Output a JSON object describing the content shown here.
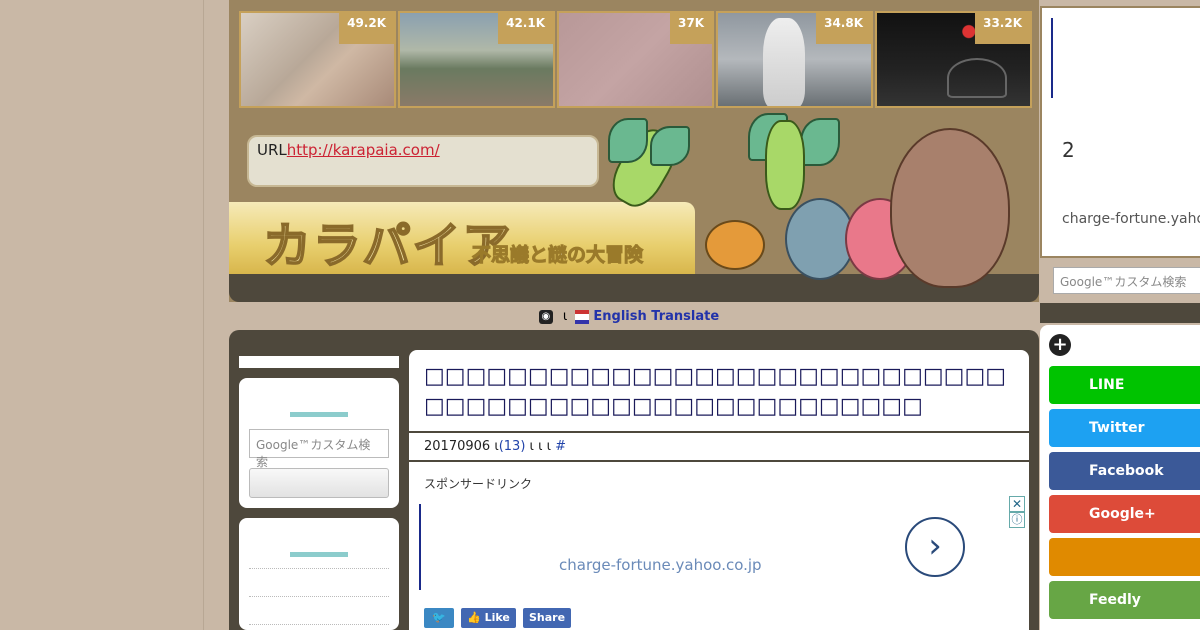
{
  "thumbnails": [
    {
      "count": "49.2K"
    },
    {
      "count": "42.1K"
    },
    {
      "count": "37K"
    },
    {
      "count": "34.8K"
    },
    {
      "count": "33.2K"
    }
  ],
  "header": {
    "url_prefix": "URL",
    "url_link": "http://karapaia.com/",
    "logo_main": "カラパイア",
    "logo_sub": "不思議と謎の大冒険"
  },
  "translate": {
    "separator": "ι",
    "label": "English Translate"
  },
  "left_sidebar": {
    "search_placeholder": "Google™カスタム検索"
  },
  "article": {
    "title": "□□□□□□□□□□□□□□□□□□□□□□□□□□□□□□□□□□□□□□□□□□□□□□□□□□□□",
    "date": "20170906",
    "sep1": "ι",
    "comments": "(13)",
    "sep2": "ι ι ι",
    "hash": "#",
    "sponsor_label": "スポンサードリンク",
    "ad_url": "charge-fortune.yahoo.co.jp",
    "ad_close": "✕",
    "ad_info": "ⓘ",
    "share_like": "Like",
    "share_share": "Share"
  },
  "right_sidebar": {
    "ad_number": "2",
    "ad_url": "charge-fortune.yahoo.co.jp",
    "search_placeholder": "Google™カスタム検索",
    "buttons": [
      {
        "label": "LINE"
      },
      {
        "label": "Twitter"
      },
      {
        "label": "Facebook"
      },
      {
        "label": "Google+"
      },
      {
        "label": ""
      },
      {
        "label": "Feedly"
      }
    ]
  },
  "colors": {
    "header_bg": "#9b8560",
    "dark_brown": "#4e483c",
    "gold": "#c5a15a",
    "page_bg": "#c9b8a6"
  }
}
